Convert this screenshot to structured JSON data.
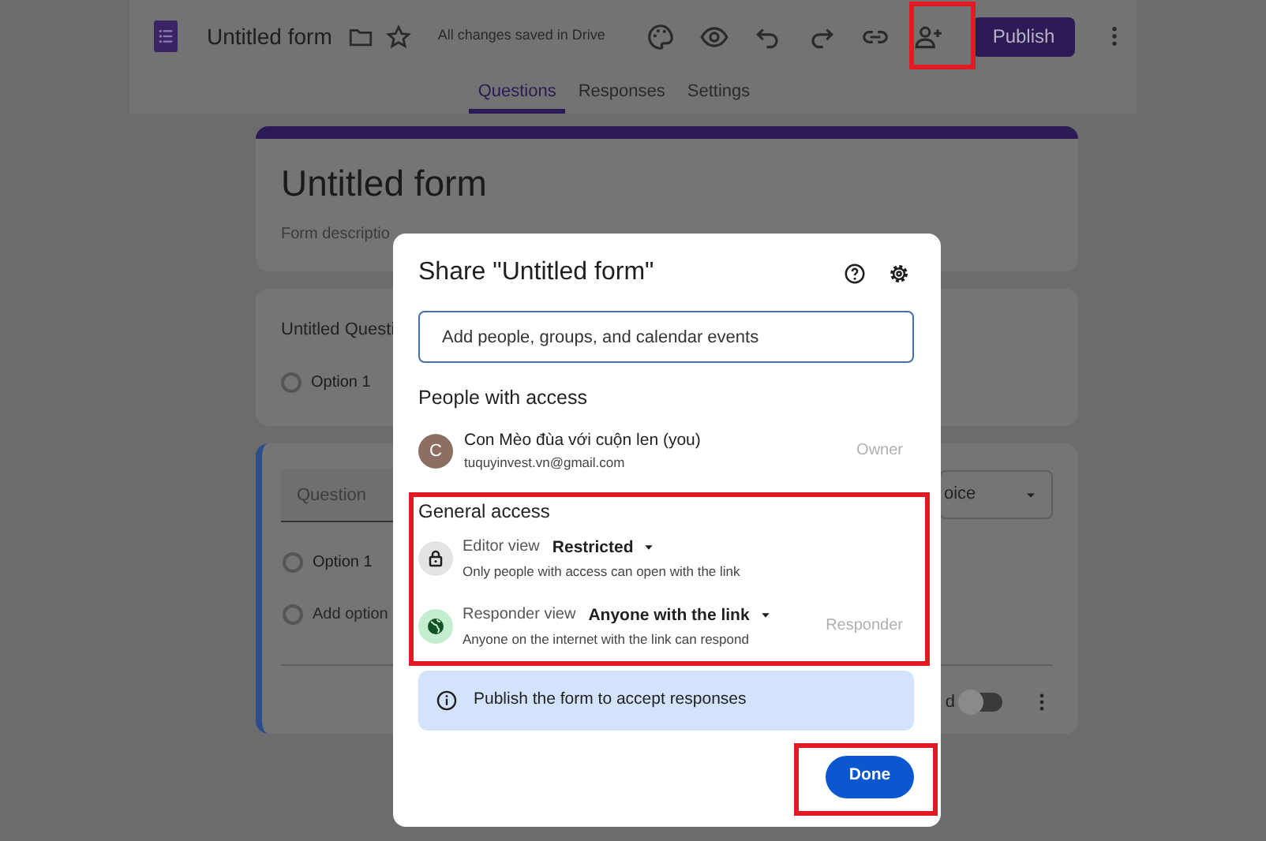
{
  "header": {
    "title": "Untitled form",
    "save_status": "All changes saved in Drive",
    "publish_button": "Publish",
    "tabs": [
      {
        "label": "Questions",
        "selected": true
      },
      {
        "label": "Responses",
        "selected": false
      },
      {
        "label": "Settings",
        "selected": false
      }
    ]
  },
  "form": {
    "title": "Untitled form",
    "description": "Form descriptio",
    "question_1": {
      "title": "Untitled Questi",
      "options": [
        {
          "label": "Option 1",
          "selected": false
        }
      ]
    },
    "question_2": {
      "placeholder": "Question",
      "type_dropdown": "oice",
      "options": [
        {
          "label": "Option 1",
          "selected": false
        }
      ],
      "add_option": {
        "label": "Add option",
        "selected": false
      },
      "required_label": "d",
      "required_on": false
    }
  },
  "dialog": {
    "title": "Share \"Untitled form\"",
    "search": {
      "placeholder": "Add people, groups, and calendar events"
    },
    "people_heading": "People with access",
    "people": [
      {
        "initial": "C",
        "name": "Con Mèo đùa với cuộn len (you)",
        "email": "tuquyinvest.vn@gmail.com",
        "role": "Owner"
      }
    ],
    "general_heading": "General access",
    "access": [
      {
        "kind": "lock",
        "label": "Editor view",
        "value": "Restricted",
        "description": "Only people with access can open with the link"
      },
      {
        "kind": "globe",
        "label": "Responder view",
        "value": "Anyone with the link",
        "description": "Anyone on the internet with the link can respond",
        "role": "Responder"
      }
    ],
    "notice": "Publish the form to accept responses",
    "done_button": "Done"
  }
}
